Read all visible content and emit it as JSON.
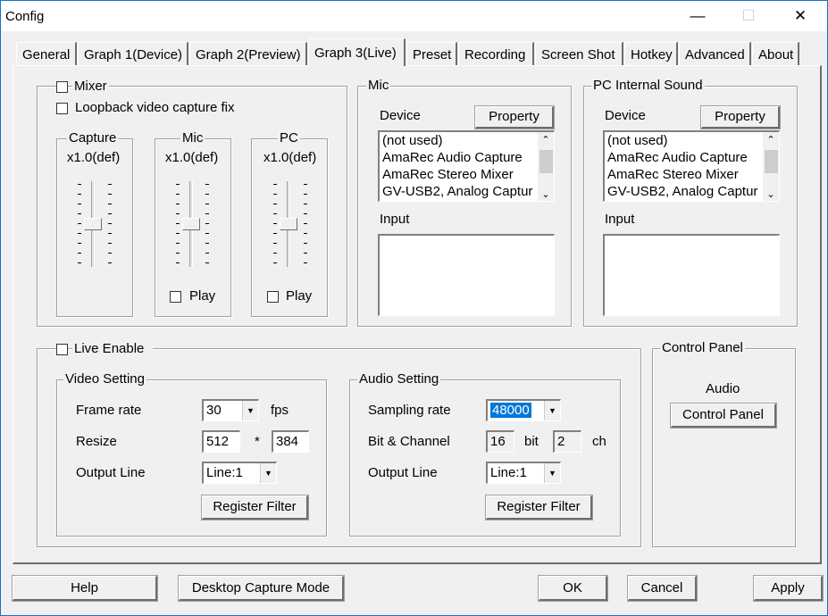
{
  "window": {
    "title": "Config",
    "minimize": "—",
    "maximize": "☐",
    "close": "✕"
  },
  "tabs": [
    "General",
    "Graph 1(Device)",
    "Graph 2(Preview)",
    "Graph 3(Live)",
    "Preset",
    "Recording",
    "Screen Shot",
    "Hotkey",
    "Advanced",
    "About"
  ],
  "mixer": {
    "mixer_label": "Mixer",
    "loopback_label": "Loopback video capture fix",
    "capture": {
      "title": "Capture",
      "value": "x1.0(def)"
    },
    "mic": {
      "title": "Mic",
      "value": "x1.0(def)",
      "play": "Play"
    },
    "pc": {
      "title": "PC",
      "value": "x1.0(def)",
      "play": "Play"
    }
  },
  "mic_group": {
    "title": "Mic",
    "device_label": "Device",
    "property": "Property",
    "devices": [
      "(not used)",
      "AmaRec Audio Capture",
      "AmaRec Stereo Mixer",
      "GV-USB2, Analog Captur"
    ],
    "input_label": "Input"
  },
  "pc_group": {
    "title": "PC Internal Sound",
    "device_label": "Device",
    "property": "Property",
    "devices": [
      "(not used)",
      "AmaRec Audio Capture",
      "AmaRec Stereo Mixer",
      "GV-USB2, Analog Captur"
    ],
    "input_label": "Input"
  },
  "live": {
    "enable_label": "Live Enable",
    "video": {
      "title": "Video Setting",
      "frame_rate_label": "Frame rate",
      "frame_rate": "30",
      "fps": "fps",
      "resize_label": "Resize",
      "width": "512",
      "times": "*",
      "height": "384",
      "output_label": "Output Line",
      "output": "Line:1",
      "register": "Register Filter"
    },
    "audio": {
      "title": "Audio Setting",
      "sampling_label": "Sampling rate",
      "sampling": "48000",
      "bit_label": "Bit & Channel",
      "bits": "16",
      "bit": "bit",
      "channels": "2",
      "ch": "ch",
      "output_label": "Output Line",
      "output": "Line:1",
      "register": "Register Filter"
    }
  },
  "control_panel": {
    "title": "Control Panel",
    "audio": "Audio",
    "button": "Control Panel"
  },
  "footer": {
    "help": "Help",
    "desktop": "Desktop Capture Mode",
    "ok": "OK",
    "cancel": "Cancel",
    "apply": "Apply"
  }
}
